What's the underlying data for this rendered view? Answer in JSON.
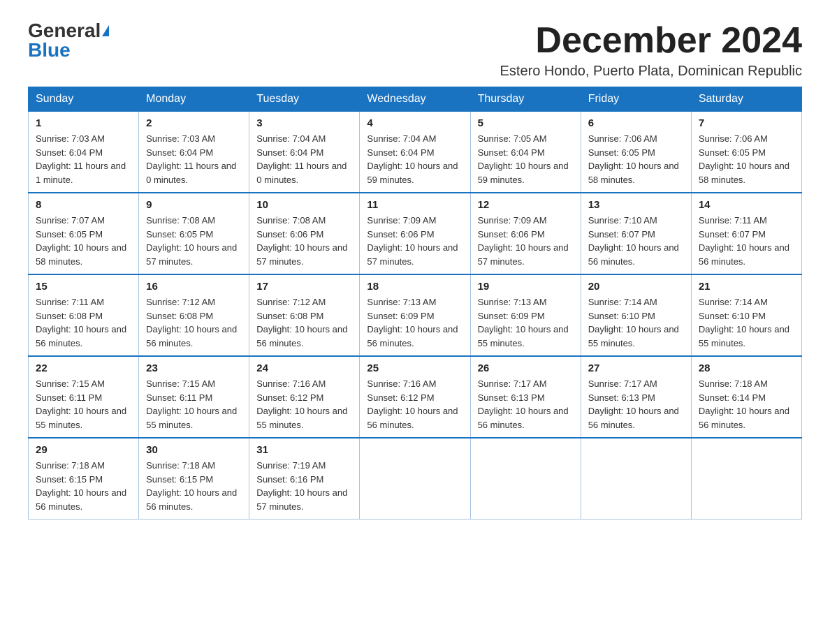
{
  "header": {
    "logo_general": "General",
    "logo_blue": "Blue",
    "month_title": "December 2024",
    "location": "Estero Hondo, Puerto Plata, Dominican Republic"
  },
  "weekdays": [
    "Sunday",
    "Monday",
    "Tuesday",
    "Wednesday",
    "Thursday",
    "Friday",
    "Saturday"
  ],
  "weeks": [
    [
      {
        "day": "1",
        "sunrise": "7:03 AM",
        "sunset": "6:04 PM",
        "daylight": "11 hours and 1 minute."
      },
      {
        "day": "2",
        "sunrise": "7:03 AM",
        "sunset": "6:04 PM",
        "daylight": "11 hours and 0 minutes."
      },
      {
        "day": "3",
        "sunrise": "7:04 AM",
        "sunset": "6:04 PM",
        "daylight": "11 hours and 0 minutes."
      },
      {
        "day": "4",
        "sunrise": "7:04 AM",
        "sunset": "6:04 PM",
        "daylight": "10 hours and 59 minutes."
      },
      {
        "day": "5",
        "sunrise": "7:05 AM",
        "sunset": "6:04 PM",
        "daylight": "10 hours and 59 minutes."
      },
      {
        "day": "6",
        "sunrise": "7:06 AM",
        "sunset": "6:05 PM",
        "daylight": "10 hours and 58 minutes."
      },
      {
        "day": "7",
        "sunrise": "7:06 AM",
        "sunset": "6:05 PM",
        "daylight": "10 hours and 58 minutes."
      }
    ],
    [
      {
        "day": "8",
        "sunrise": "7:07 AM",
        "sunset": "6:05 PM",
        "daylight": "10 hours and 58 minutes."
      },
      {
        "day": "9",
        "sunrise": "7:08 AM",
        "sunset": "6:05 PM",
        "daylight": "10 hours and 57 minutes."
      },
      {
        "day": "10",
        "sunrise": "7:08 AM",
        "sunset": "6:06 PM",
        "daylight": "10 hours and 57 minutes."
      },
      {
        "day": "11",
        "sunrise": "7:09 AM",
        "sunset": "6:06 PM",
        "daylight": "10 hours and 57 minutes."
      },
      {
        "day": "12",
        "sunrise": "7:09 AM",
        "sunset": "6:06 PM",
        "daylight": "10 hours and 57 minutes."
      },
      {
        "day": "13",
        "sunrise": "7:10 AM",
        "sunset": "6:07 PM",
        "daylight": "10 hours and 56 minutes."
      },
      {
        "day": "14",
        "sunrise": "7:11 AM",
        "sunset": "6:07 PM",
        "daylight": "10 hours and 56 minutes."
      }
    ],
    [
      {
        "day": "15",
        "sunrise": "7:11 AM",
        "sunset": "6:08 PM",
        "daylight": "10 hours and 56 minutes."
      },
      {
        "day": "16",
        "sunrise": "7:12 AM",
        "sunset": "6:08 PM",
        "daylight": "10 hours and 56 minutes."
      },
      {
        "day": "17",
        "sunrise": "7:12 AM",
        "sunset": "6:08 PM",
        "daylight": "10 hours and 56 minutes."
      },
      {
        "day": "18",
        "sunrise": "7:13 AM",
        "sunset": "6:09 PM",
        "daylight": "10 hours and 56 minutes."
      },
      {
        "day": "19",
        "sunrise": "7:13 AM",
        "sunset": "6:09 PM",
        "daylight": "10 hours and 55 minutes."
      },
      {
        "day": "20",
        "sunrise": "7:14 AM",
        "sunset": "6:10 PM",
        "daylight": "10 hours and 55 minutes."
      },
      {
        "day": "21",
        "sunrise": "7:14 AM",
        "sunset": "6:10 PM",
        "daylight": "10 hours and 55 minutes."
      }
    ],
    [
      {
        "day": "22",
        "sunrise": "7:15 AM",
        "sunset": "6:11 PM",
        "daylight": "10 hours and 55 minutes."
      },
      {
        "day": "23",
        "sunrise": "7:15 AM",
        "sunset": "6:11 PM",
        "daylight": "10 hours and 55 minutes."
      },
      {
        "day": "24",
        "sunrise": "7:16 AM",
        "sunset": "6:12 PM",
        "daylight": "10 hours and 55 minutes."
      },
      {
        "day": "25",
        "sunrise": "7:16 AM",
        "sunset": "6:12 PM",
        "daylight": "10 hours and 56 minutes."
      },
      {
        "day": "26",
        "sunrise": "7:17 AM",
        "sunset": "6:13 PM",
        "daylight": "10 hours and 56 minutes."
      },
      {
        "day": "27",
        "sunrise": "7:17 AM",
        "sunset": "6:13 PM",
        "daylight": "10 hours and 56 minutes."
      },
      {
        "day": "28",
        "sunrise": "7:18 AM",
        "sunset": "6:14 PM",
        "daylight": "10 hours and 56 minutes."
      }
    ],
    [
      {
        "day": "29",
        "sunrise": "7:18 AM",
        "sunset": "6:15 PM",
        "daylight": "10 hours and 56 minutes."
      },
      {
        "day": "30",
        "sunrise": "7:18 AM",
        "sunset": "6:15 PM",
        "daylight": "10 hours and 56 minutes."
      },
      {
        "day": "31",
        "sunrise": "7:19 AM",
        "sunset": "6:16 PM",
        "daylight": "10 hours and 57 minutes."
      },
      null,
      null,
      null,
      null
    ]
  ]
}
